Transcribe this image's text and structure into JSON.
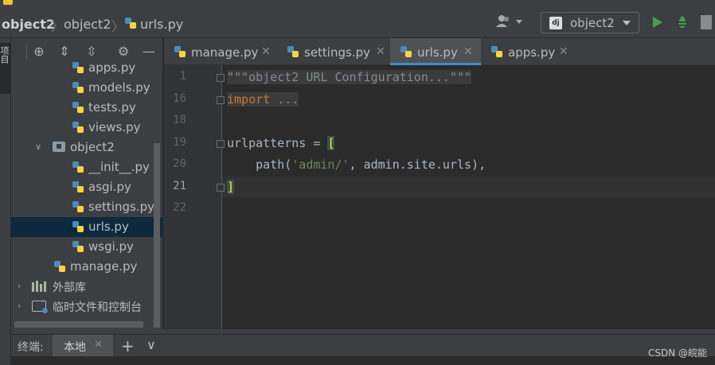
{
  "breadcrumb": {
    "project": "object2",
    "folder": "object2",
    "file": "urls.py"
  },
  "run_config": {
    "label": "object2",
    "badge": "dj"
  },
  "project_tree": {
    "items": [
      {
        "label": "apps.py",
        "kind": "py",
        "selected": false
      },
      {
        "label": "models.py",
        "kind": "py",
        "selected": false
      },
      {
        "label": "tests.py",
        "kind": "py",
        "selected": false
      },
      {
        "label": "views.py",
        "kind": "py",
        "selected": false
      },
      {
        "label": "object2",
        "kind": "folder",
        "selected": false
      },
      {
        "label": "__init__.py",
        "kind": "py",
        "selected": false
      },
      {
        "label": "asgi.py",
        "kind": "py",
        "selected": false
      },
      {
        "label": "settings.py",
        "kind": "py",
        "selected": false
      },
      {
        "label": "urls.py",
        "kind": "py",
        "selected": true
      },
      {
        "label": "wsgi.py",
        "kind": "py",
        "selected": false
      },
      {
        "label": "manage.py",
        "kind": "py",
        "selected": false
      },
      {
        "label": "外部库",
        "kind": "library",
        "selected": false
      },
      {
        "label": "临时文件和控制台",
        "kind": "scratch",
        "selected": false
      }
    ]
  },
  "tabs": [
    {
      "label": "manage.py",
      "close": "✕",
      "active": false
    },
    {
      "label": "settings.py",
      "close": "✕",
      "active": false
    },
    {
      "label": "urls.py",
      "close": "✕",
      "active": true
    },
    {
      "label": "apps.py",
      "close": "✕",
      "active": false
    }
  ],
  "editor": {
    "line_numbers": [
      "1",
      "16",
      "18",
      "19",
      "20",
      "21",
      "22"
    ],
    "current_line": "21",
    "code": {
      "line1": "\"\"\"object2 URL Configuration...\"\"\"",
      "line16_kw": "import",
      "line16_rest": " ...",
      "line19_a": "urlpatterns = ",
      "line19_b": "[",
      "line20_a": "    path(",
      "line20_str": "'admin/'",
      "line20_b": ", admin.site.urls),",
      "line21": "]"
    }
  },
  "terminal": {
    "title": "终端:",
    "tab_label": "本地",
    "tab_close": "✕",
    "add": "+",
    "menu": "∨"
  },
  "watermark": "CSDN @皖能",
  "colors": {
    "keyword": "#cc7832",
    "string": "#6a8759",
    "selection": "#0d293e",
    "accent": "#4a88c7",
    "run_green": "#499c54"
  }
}
